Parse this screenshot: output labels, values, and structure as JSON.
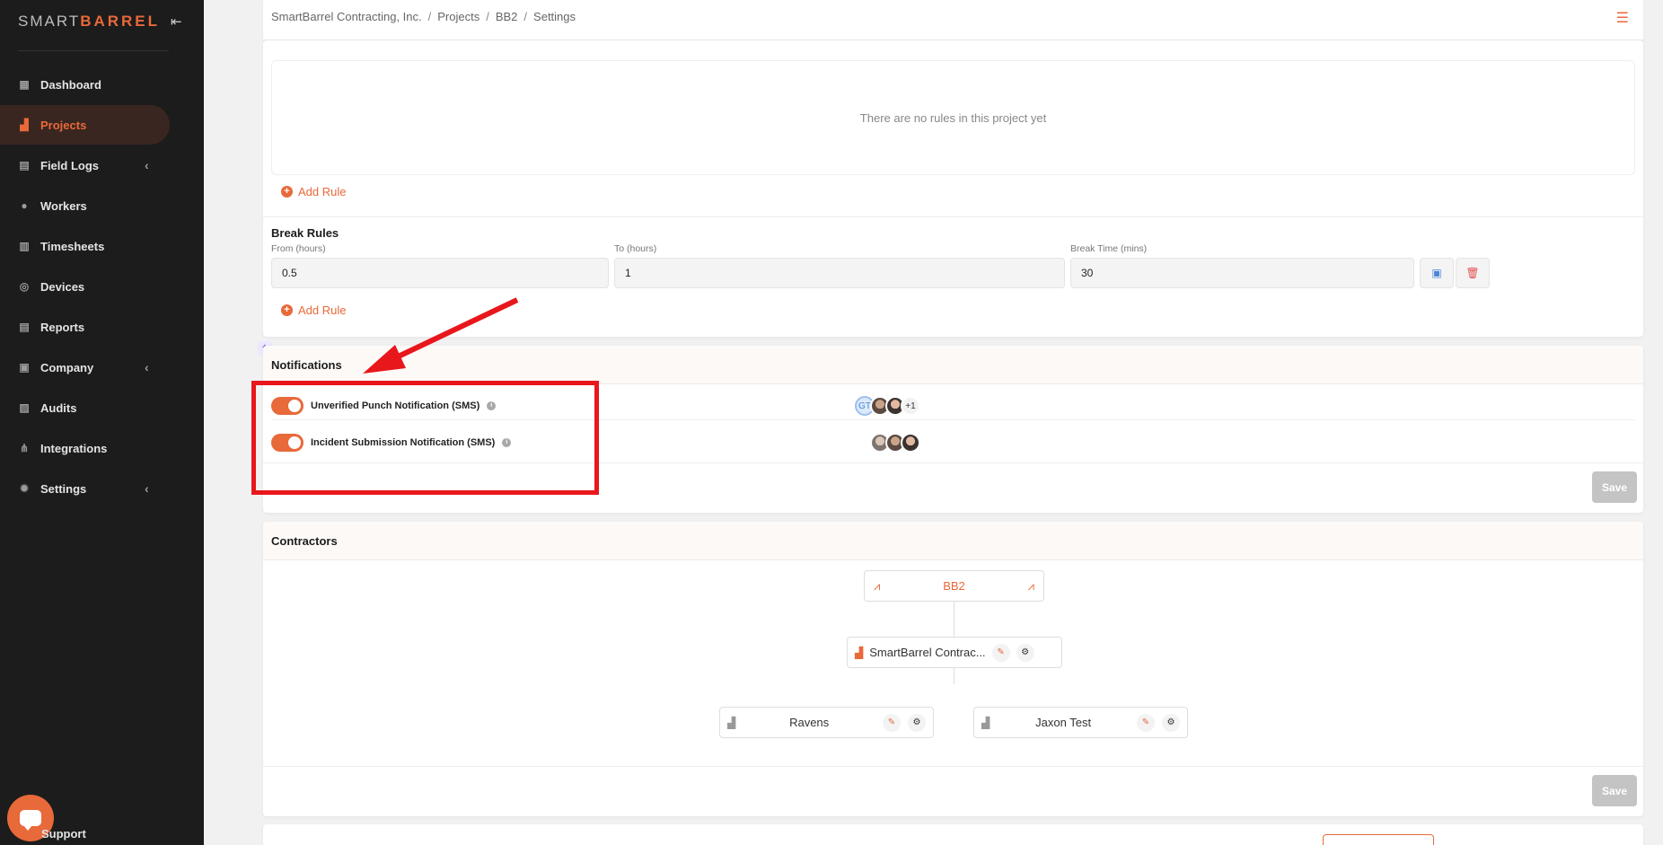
{
  "sidebar": {
    "logo_prefix": "SMART",
    "logo_brand": "BARREL",
    "collapse_icon": "collapse-left-icon",
    "items": [
      {
        "label": "Dashboard",
        "icon": "dashboard-icon",
        "active": false,
        "expandable": false
      },
      {
        "label": "Projects",
        "icon": "projects-icon",
        "active": true,
        "expandable": false
      },
      {
        "label": "Field Logs",
        "icon": "clipboard-icon",
        "active": false,
        "expandable": true
      },
      {
        "label": "Workers",
        "icon": "worker-icon",
        "active": false,
        "expandable": false
      },
      {
        "label": "Timesheets",
        "icon": "timesheet-icon",
        "active": false,
        "expandable": false
      },
      {
        "label": "Devices",
        "icon": "device-icon",
        "active": false,
        "expandable": false
      },
      {
        "label": "Reports",
        "icon": "report-icon",
        "active": false,
        "expandable": false
      },
      {
        "label": "Company",
        "icon": "briefcase-icon",
        "active": false,
        "expandable": true
      },
      {
        "label": "Audits",
        "icon": "audit-icon",
        "active": false,
        "expandable": false
      },
      {
        "label": "Integrations",
        "icon": "integrations-icon",
        "active": false,
        "expandable": false
      },
      {
        "label": "Settings",
        "icon": "gear-icon",
        "active": false,
        "expandable": true
      }
    ],
    "support_label": "Support"
  },
  "breadcrumb": [
    "SmartBarrel Contracting, Inc.",
    "Projects",
    "BB2",
    "Settings"
  ],
  "rules": {
    "empty_text": "There are no rules in this project yet",
    "add_rule_label": "Add Rule"
  },
  "break_rules": {
    "title": "Break Rules",
    "from_label": "From (hours)",
    "to_label": "To (hours)",
    "break_label": "Break Time (mins)",
    "from_value": "0.5",
    "to_value": "1",
    "break_value": "30",
    "add_rule_label": "Add Rule"
  },
  "notifications": {
    "title": "Notifications",
    "items": [
      {
        "label": "Unverified Punch Notification (SMS)",
        "enabled": true,
        "avatar_initials": "GT",
        "more": "+1"
      },
      {
        "label": "Incident Submission Notification (SMS)",
        "enabled": true
      }
    ],
    "save_label": "Save"
  },
  "contractors": {
    "title": "Contractors",
    "root": "BB2",
    "primary": "SmartBarrel Contrac...",
    "children": [
      "Ravens",
      "Jaxon Test"
    ],
    "save_label": "Save"
  },
  "colors": {
    "accent": "#e8693a",
    "sidebar_bg": "#1c1c1c",
    "highlight": "#e8171c"
  }
}
